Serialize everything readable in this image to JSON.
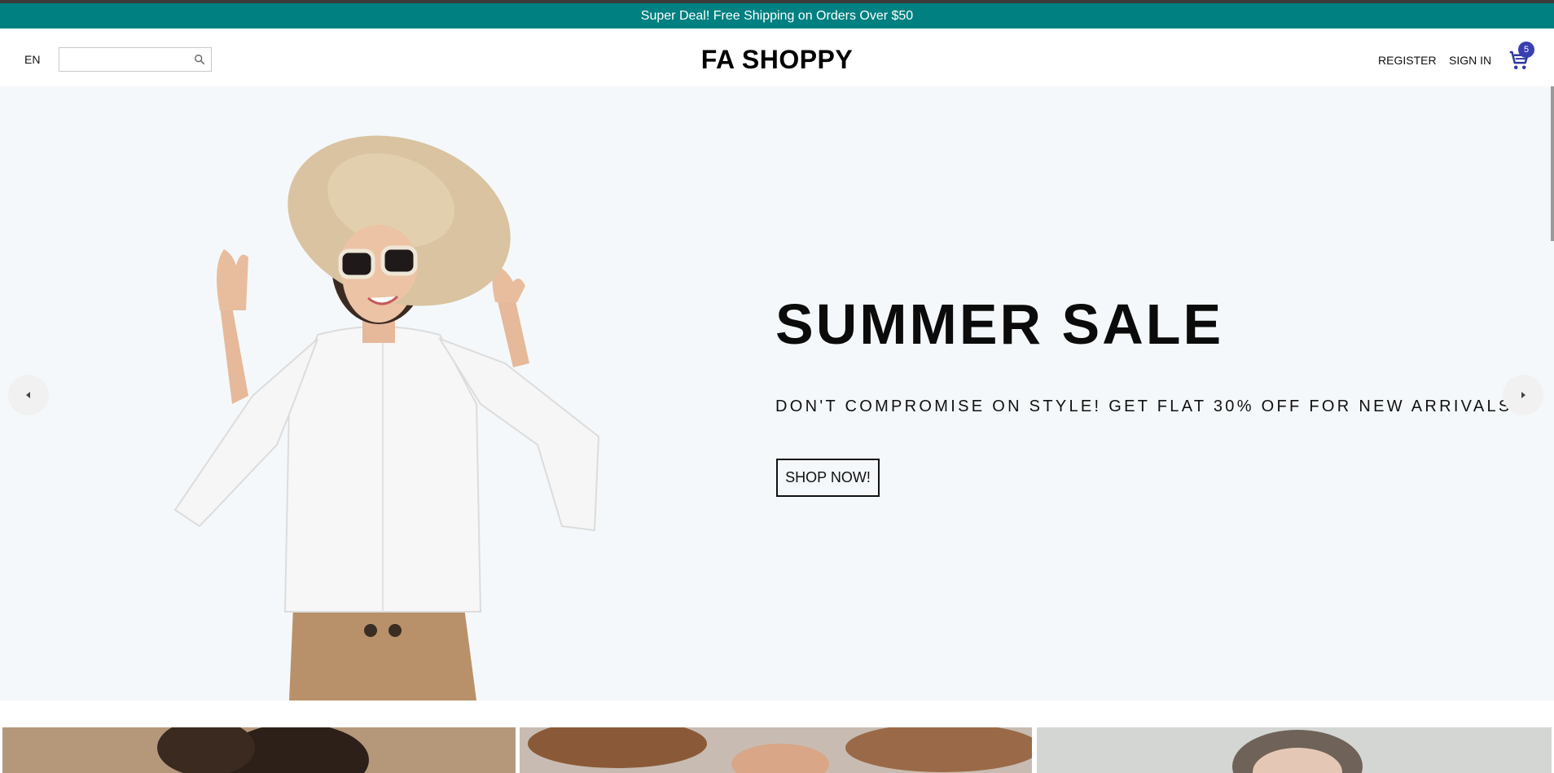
{
  "announcement": {
    "text": "Super Deal! Free Shipping on Orders Over $50",
    "color": "#008080"
  },
  "header": {
    "language": "EN",
    "search": {
      "placeholder": "",
      "value": "",
      "icon": "search-icon"
    },
    "logo": "FA SHOPPY",
    "register_label": "REGISTER",
    "signin_label": "SIGN IN",
    "cart": {
      "icon": "cart-icon",
      "count": "5",
      "badge_color": "#3a3fb0"
    }
  },
  "hero": {
    "title": "SUMMER SALE",
    "description": "DON'T COMPROMISE ON STYLE! GET FLAT 30% OFF FOR NEW ARRIVALS.",
    "button_label": "SHOP NOW!",
    "background": "#f4f8fa",
    "image": "woman-in-sun-hat-photo",
    "prev_icon": "arrow-left-icon",
    "next_icon": "arrow-right-icon"
  },
  "categories": [
    {
      "image": "category-photo-1"
    },
    {
      "image": "category-photo-2"
    },
    {
      "image": "category-photo-3"
    }
  ]
}
